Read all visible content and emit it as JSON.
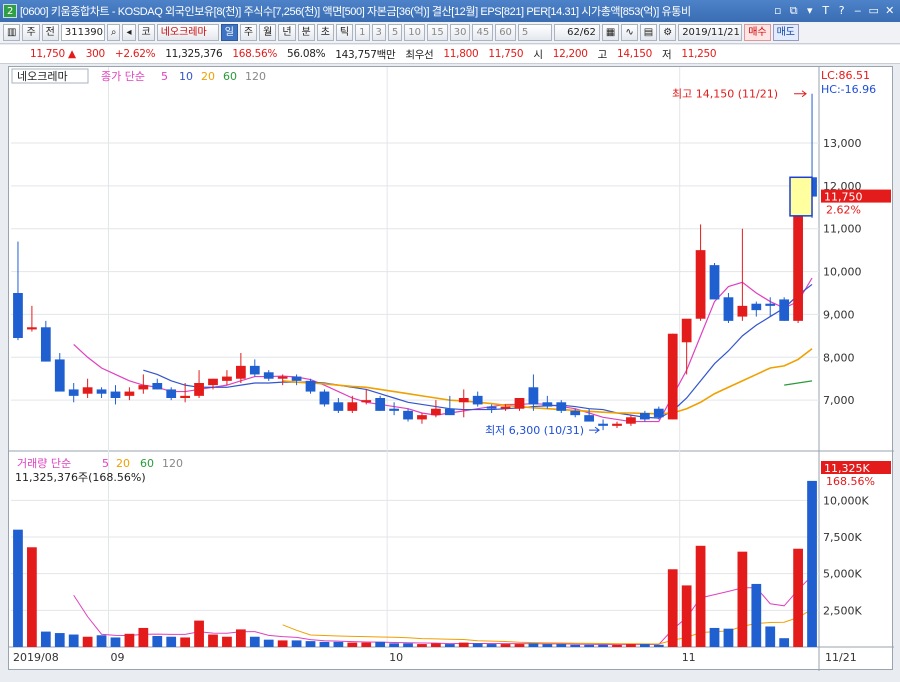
{
  "titlebar": {
    "window_num": "2",
    "title": "[0600] 키움종합차트 - KOSDAQ 외국인보유[8(천)] 주식수[7,256(천)] 액면[500] 자본금[36(억)] 결산[12월] EPS[821] PER[14.31] 시가총액[853(억)] 유통비",
    "buttons": [
      "▫",
      "⧉",
      "▾",
      "T",
      "?",
      "‒",
      "▭",
      "✕"
    ]
  },
  "toolbar": {
    "mode1": "주",
    "mode2": "전",
    "code": "311390",
    "market": "코",
    "name": "네오크레마",
    "periods": [
      "일",
      "주",
      "월",
      "년",
      "분",
      "초",
      "틱"
    ],
    "minutes": [
      "1",
      "3",
      "5",
      "10",
      "15",
      "30",
      "45",
      "60"
    ],
    "interval": "5",
    "count": "62/62",
    "date": "2019/11/21",
    "buy": "매수",
    "sell": "매도"
  },
  "quote": {
    "price": "11,750 ▲",
    "change": "300",
    "pct": "+2.62%",
    "volume": "11,325,376",
    "vol_pct": "168.56%",
    "turnover": "56.08%",
    "amount": "143,757백만",
    "priority_label": "최우선",
    "ask": "11,800",
    "bid": "11,750",
    "open_label": "시",
    "open": "12,200",
    "high_label": "고",
    "high": "14,150",
    "low_label": "저",
    "low": "11,250"
  },
  "chart": {
    "name_box": "네오크레마",
    "legend": {
      "label": "종가 단순",
      "p5": "5",
      "p10": "10",
      "p20": "20",
      "p60": "60",
      "p120": "120"
    },
    "max_label": "최고 14,150 (11/21)",
    "min_label": "최저 6,300 (10/31)",
    "lc": "LC:86.51",
    "hc": "HC:-16.96",
    "cur_price": "11,750",
    "cur_pct": "2.62%",
    "yticks": [
      "13,000",
      "12,000",
      "11,000",
      "10,000",
      "9,000",
      "8,000",
      "7,000"
    ],
    "vol_legend": {
      "label": "거래량 단순",
      "p5": "5",
      "p20": "20",
      "p60": "60",
      "p120": "120"
    },
    "vol_value": "11,325,376주(168.56%)",
    "vol_cur": "11,325K",
    "vol_cur_pct": "168.56%",
    "vol_yticks": [
      "10,000K",
      "7,500K",
      "5,000K",
      "2,500K"
    ],
    "xticks": [
      "2019/08",
      "09",
      "10",
      "11",
      "11/21"
    ],
    "colors": {
      "up": "#e31b1b",
      "down": "#1f5fd0",
      "ma5": "#e040c0",
      "ma10": "#3355cc",
      "ma20": "#f0a000",
      "ma60": "#2a9a3a"
    }
  },
  "chart_data": {
    "type": "candlestick",
    "price_range": [
      6000,
      14400
    ],
    "candles": [
      {
        "o": 9500,
        "h": 10700,
        "l": 8400,
        "c": 8450
      },
      {
        "o": 8650,
        "h": 9200,
        "l": 8600,
        "c": 8700
      },
      {
        "o": 8700,
        "h": 8850,
        "l": 7900,
        "c": 7900
      },
      {
        "o": 7950,
        "h": 8100,
        "l": 7300,
        "c": 7200
      },
      {
        "o": 7250,
        "h": 7400,
        "l": 6950,
        "c": 7100
      },
      {
        "o": 7150,
        "h": 7500,
        "l": 7050,
        "c": 7300
      },
      {
        "o": 7250,
        "h": 7300,
        "l": 7050,
        "c": 7150
      },
      {
        "o": 7200,
        "h": 7350,
        "l": 6900,
        "c": 7050
      },
      {
        "o": 7100,
        "h": 7300,
        "l": 7000,
        "c": 7200
      },
      {
        "o": 7250,
        "h": 7600,
        "l": 7150,
        "c": 7350
      },
      {
        "o": 7400,
        "h": 7500,
        "l": 7250,
        "c": 7250
      },
      {
        "o": 7250,
        "h": 7300,
        "l": 7000,
        "c": 7050
      },
      {
        "o": 7050,
        "h": 7400,
        "l": 6950,
        "c": 7100
      },
      {
        "o": 7100,
        "h": 7700,
        "l": 7050,
        "c": 7400
      },
      {
        "o": 7350,
        "h": 7500,
        "l": 7250,
        "c": 7500
      },
      {
        "o": 7450,
        "h": 7700,
        "l": 7350,
        "c": 7550
      },
      {
        "o": 7500,
        "h": 8100,
        "l": 7400,
        "c": 7800
      },
      {
        "o": 7800,
        "h": 7950,
        "l": 7550,
        "c": 7600
      },
      {
        "o": 7650,
        "h": 7700,
        "l": 7450,
        "c": 7500
      },
      {
        "o": 7500,
        "h": 7600,
        "l": 7350,
        "c": 7550
      },
      {
        "o": 7550,
        "h": 7600,
        "l": 7350,
        "c": 7450
      },
      {
        "o": 7450,
        "h": 7500,
        "l": 7150,
        "c": 7200
      },
      {
        "o": 7200,
        "h": 7250,
        "l": 6850,
        "c": 6900
      },
      {
        "o": 6950,
        "h": 7050,
        "l": 6700,
        "c": 6750
      },
      {
        "o": 6750,
        "h": 7100,
        "l": 6700,
        "c": 6950
      },
      {
        "o": 6950,
        "h": 7250,
        "l": 6900,
        "c": 7000
      },
      {
        "o": 7050,
        "h": 7100,
        "l": 6750,
        "c": 6750
      },
      {
        "o": 6800,
        "h": 6950,
        "l": 6650,
        "c": 6750
      },
      {
        "o": 6750,
        "h": 6800,
        "l": 6500,
        "c": 6550
      },
      {
        "o": 6550,
        "h": 6700,
        "l": 6450,
        "c": 6650
      },
      {
        "o": 6650,
        "h": 7000,
        "l": 6600,
        "c": 6800
      },
      {
        "o": 6800,
        "h": 7100,
        "l": 6750,
        "c": 6650
      },
      {
        "o": 6950,
        "h": 7250,
        "l": 6600,
        "c": 7050
      },
      {
        "o": 7100,
        "h": 7200,
        "l": 6850,
        "c": 6900
      },
      {
        "o": 6850,
        "h": 6900,
        "l": 6700,
        "c": 6800
      },
      {
        "o": 6800,
        "h": 6900,
        "l": 6750,
        "c": 6850
      },
      {
        "o": 6800,
        "h": 7050,
        "l": 6750,
        "c": 7050
      },
      {
        "o": 7300,
        "h": 7600,
        "l": 6750,
        "c": 6900
      },
      {
        "o": 6950,
        "h": 7100,
        "l": 6800,
        "c": 6850
      },
      {
        "o": 6950,
        "h": 7000,
        "l": 6700,
        "c": 6750
      },
      {
        "o": 6750,
        "h": 6800,
        "l": 6600,
        "c": 6650
      },
      {
        "o": 6650,
        "h": 6800,
        "l": 6550,
        "c": 6500
      },
      {
        "o": 6450,
        "h": 6550,
        "l": 6300,
        "c": 6400
      },
      {
        "o": 6400,
        "h": 6500,
        "l": 6350,
        "c": 6450
      },
      {
        "o": 6450,
        "h": 6650,
        "l": 6400,
        "c": 6600
      },
      {
        "o": 6700,
        "h": 6750,
        "l": 6500,
        "c": 6550
      },
      {
        "o": 6800,
        "h": 6850,
        "l": 6550,
        "c": 6600
      },
      {
        "o": 6550,
        "h": 8550,
        "l": 6550,
        "c": 8550
      },
      {
        "o": 8350,
        "h": 8650,
        "l": 7600,
        "c": 8900
      },
      {
        "o": 8900,
        "h": 11100,
        "l": 8850,
        "c": 10500
      },
      {
        "o": 10150,
        "h": 10200,
        "l": 9500,
        "c": 9350
      },
      {
        "o": 9400,
        "h": 9500,
        "l": 8800,
        "c": 8850
      },
      {
        "o": 8950,
        "h": 11000,
        "l": 8850,
        "c": 9200
      },
      {
        "o": 9250,
        "h": 9300,
        "l": 8950,
        "c": 9100
      },
      {
        "o": 9250,
        "h": 9400,
        "l": 8950,
        "c": 9200
      },
      {
        "o": 9350,
        "h": 9400,
        "l": 8850,
        "c": 8850
      },
      {
        "o": 8850,
        "h": 11350,
        "l": 8800,
        "c": 11450
      },
      {
        "o": 12200,
        "h": 14150,
        "l": 11250,
        "c": 11750
      }
    ],
    "volume": [
      8000,
      6800,
      1050,
      950,
      850,
      700,
      800,
      650,
      900,
      1300,
      750,
      700,
      650,
      1800,
      850,
      700,
      1200,
      700,
      500,
      450,
      450,
      400,
      350,
      350,
      300,
      300,
      350,
      250,
      250,
      200,
      250,
      200,
      300,
      250,
      200,
      200,
      200,
      250,
      200,
      200,
      150,
      150,
      150,
      150,
      200,
      200,
      150,
      5300,
      4200,
      6900,
      1300,
      1250,
      6500,
      4300,
      1400,
      600,
      6700,
      11325
    ],
    "ma5": [
      null,
      null,
      null,
      null,
      8300,
      8000,
      7750,
      7600,
      7450,
      7350,
      7300,
      7200,
      7200,
      7250,
      7300,
      7350,
      7450,
      7550,
      7550,
      7560,
      7540,
      7480,
      7350,
      7200,
      7050,
      6950,
      6900,
      6850,
      6800,
      6700,
      6650,
      6700,
      6750,
      6800,
      6850,
      6900,
      6900,
      6920,
      6900,
      6850,
      6800,
      6700,
      6600,
      6550,
      6500,
      6500,
      6500,
      7100,
      7700,
      8500,
      9300,
      9650,
      9750,
      9500,
      9300,
      9150,
      9300,
      9850
    ],
    "ma10": [
      null,
      null,
      null,
      null,
      null,
      null,
      null,
      null,
      null,
      7700,
      7600,
      7450,
      7350,
      7300,
      7300,
      7300,
      7350,
      7400,
      7400,
      7420,
      7420,
      7420,
      7400,
      7350,
      7300,
      7250,
      7150,
      7050,
      6950,
      6900,
      6850,
      6800,
      6780,
      6780,
      6780,
      6800,
      6820,
      6850,
      6870,
      6880,
      6850,
      6800,
      6780,
      6700,
      6650,
      6600,
      6580,
      6750,
      7050,
      7450,
      7850,
      8150,
      8500,
      8750,
      8950,
      9150,
      9450,
      9700
    ],
    "ma20": [
      null,
      null,
      null,
      null,
      null,
      null,
      null,
      null,
      null,
      null,
      null,
      null,
      null,
      null,
      null,
      null,
      null,
      null,
      null,
      7450,
      7420,
      7400,
      7380,
      7350,
      7320,
      7300,
      7250,
      7200,
      7150,
      7100,
      7050,
      7000,
      6980,
      6950,
      6920,
      6880,
      6850,
      6820,
      6800,
      6780,
      6760,
      6740,
      6720,
      6700,
      6700,
      6690,
      6680,
      6700,
      6800,
      6950,
      7150,
      7300,
      7450,
      7600,
      7750,
      7800,
      7950,
      8200
    ],
    "ma60": [
      null,
      null,
      null,
      null,
      null,
      null,
      null,
      null,
      null,
      null,
      null,
      null,
      null,
      null,
      null,
      null,
      null,
      null,
      null,
      null,
      null,
      null,
      null,
      null,
      null,
      null,
      null,
      null,
      null,
      null,
      null,
      null,
      null,
      null,
      null,
      null,
      null,
      null,
      null,
      null,
      null,
      null,
      null,
      null,
      null,
      null,
      null,
      null,
      null,
      null,
      null,
      null,
      null,
      null,
      null,
      7350,
      7400,
      7450
    ],
    "xticks": [
      "2019/08",
      "09",
      "10",
      "11",
      "11/21"
    ]
  }
}
